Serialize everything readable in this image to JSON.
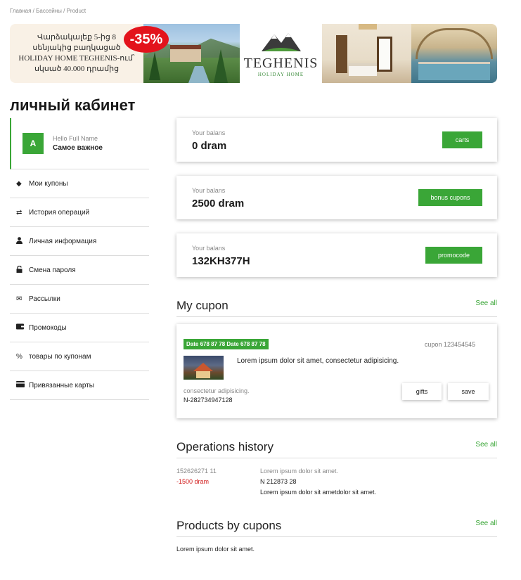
{
  "breadcrumb": "Главная / Бассейны / Product",
  "banner": {
    "text_lines": [
      "Վարձակալեք 5-ից 8",
      "սենյակից բաղկացած",
      "HOLIDAY HOME TEGHENIS-ում՝",
      "սկսած 40.000 դրամից"
    ],
    "discount": "-35%",
    "logo_word": "TEGHENIS",
    "logo_sub": "HOLIDAY HOME"
  },
  "page_title": "личный кабинет",
  "profile": {
    "avatar_letter": "A",
    "hello": "Hello Full Name",
    "subtitle": "Самое важное"
  },
  "menu": [
    {
      "label": "Мои купоны",
      "icon": "tag-icon",
      "glyph": "🏷"
    },
    {
      "label": "История операций",
      "icon": "swap-arrows-icon",
      "glyph": "⇄"
    },
    {
      "label": "Личная информация",
      "icon": "user-icon",
      "glyph": "👤"
    },
    {
      "label": "Смена пароля",
      "icon": "lock-icon",
      "glyph": "🔓"
    },
    {
      "label": "Рассылки",
      "icon": "envelope-icon",
      "glyph": "✉"
    },
    {
      "label": "Промокоды",
      "icon": "wallet-icon",
      "glyph": "▬"
    },
    {
      "label": "товары по купонам",
      "icon": "percent-icon",
      "glyph": "%"
    },
    {
      "label": "Привязанные карты",
      "icon": "credit-card-icon",
      "glyph": "▭"
    }
  ],
  "balances": [
    {
      "label": "Your balans",
      "value": "0 dram",
      "button": "carts"
    },
    {
      "label": "Your balans",
      "value": "2500 dram",
      "button": "bonus cupons"
    },
    {
      "label": "Your balans",
      "value": "132KH377H",
      "button": "promocode"
    }
  ],
  "my_cupon": {
    "title": "My cupon",
    "see_all": "See all",
    "date_badge": "Date 678 87 78 Date 678 87 78",
    "cupon_number": "cupon 123454545",
    "description": "Lorem ipsum dolor sit amet, consectetur adipisicing.",
    "sub_text": "consectetur adipisicing.",
    "n_code": "N-282734947128",
    "gifts_label": "gifts",
    "save_label": "save"
  },
  "operations": {
    "title": "Operations history",
    "see_all": "See all",
    "id": "152626271 11",
    "amount": "-1500 dram",
    "line1": "Lorem ipsum dolor sit amet.",
    "line2": "N 212873 28",
    "line3": "Lorem ipsum dolor sit ametdolor sit amet."
  },
  "products": {
    "title": "Products by cupons",
    "see_all": "See all",
    "text": "Lorem ipsum dolor sit amet."
  },
  "colors": {
    "accent_green": "#3aa637",
    "negative_red": "#d11a1a",
    "sale_red": "#e3131c"
  }
}
